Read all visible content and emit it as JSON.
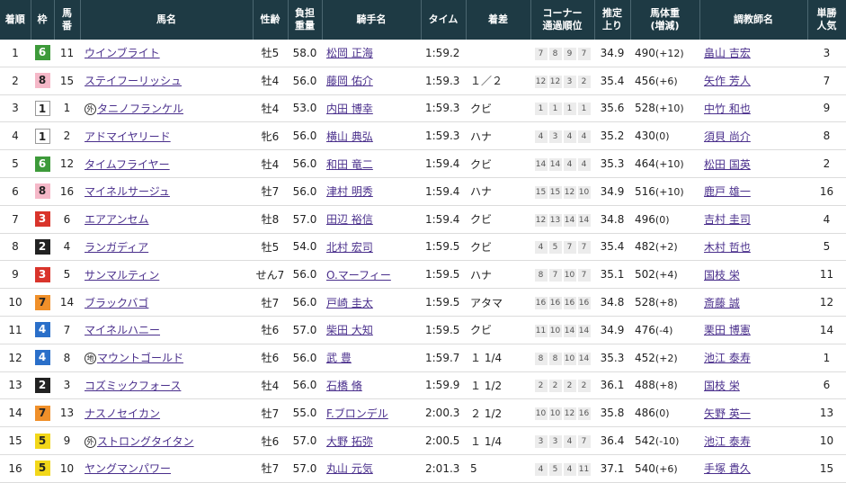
{
  "headers": {
    "rank": "着順",
    "waku": "枠",
    "uma": "馬番",
    "horse": "馬名",
    "sexage": "性齢",
    "weight": "負担重量",
    "jockey": "騎手名",
    "time": "タイム",
    "margin": "着差",
    "corner": "コーナー通過順位",
    "last": "推定上り",
    "bodyweight": "馬体重(増減)",
    "trainer": "調教師名",
    "odds": "単勝人気"
  },
  "mark_labels": {
    "gai": "外",
    "chi": "地"
  },
  "colors": {
    "header_bg": "#1e3a44",
    "link": "#4a2f8c"
  },
  "rows": [
    {
      "rank": "1",
      "waku": "6",
      "uma": "11",
      "mark": "",
      "horse": "ウインブライト",
      "sexage": "牡5",
      "weight": "58.0",
      "jockey": "松岡 正海",
      "time": "1:59.2",
      "margin": "",
      "corner": [
        "7",
        "8",
        "9",
        "7"
      ],
      "last": "34.9",
      "bodyweight": "490",
      "diff": "(+12)",
      "trainer": "畠山 吉宏",
      "odds": "3"
    },
    {
      "rank": "2",
      "waku": "8",
      "uma": "15",
      "mark": "",
      "horse": "ステイフーリッシュ",
      "sexage": "牡4",
      "weight": "56.0",
      "jockey": "藤岡 佑介",
      "time": "1:59.3",
      "margin": "１／２",
      "corner": [
        "12",
        "12",
        "3",
        "2"
      ],
      "last": "35.4",
      "bodyweight": "456",
      "diff": "(+6)",
      "trainer": "矢作 芳人",
      "odds": "7"
    },
    {
      "rank": "3",
      "waku": "1",
      "uma": "1",
      "mark": "外",
      "horse": "タニノフランケル",
      "sexage": "牡4",
      "weight": "53.0",
      "jockey": "内田 博幸",
      "time": "1:59.3",
      "margin": "クビ",
      "corner": [
        "1",
        "1",
        "1",
        "1"
      ],
      "last": "35.6",
      "bodyweight": "528",
      "diff": "(+10)",
      "trainer": "中竹 和也",
      "odds": "9"
    },
    {
      "rank": "4",
      "waku": "1",
      "uma": "2",
      "mark": "",
      "horse": "アドマイヤリード",
      "sexage": "牝6",
      "weight": "56.0",
      "jockey": "横山 典弘",
      "time": "1:59.3",
      "margin": "ハナ",
      "corner": [
        "4",
        "3",
        "4",
        "4"
      ],
      "last": "35.2",
      "bodyweight": "430",
      "diff": "(0)",
      "trainer": "須貝 尚介",
      "odds": "8"
    },
    {
      "rank": "5",
      "waku": "6",
      "uma": "12",
      "mark": "",
      "horse": "タイムフライヤー",
      "sexage": "牡4",
      "weight": "56.0",
      "jockey": "和田 竜二",
      "time": "1:59.4",
      "margin": "クビ",
      "corner": [
        "14",
        "14",
        "4",
        "4"
      ],
      "last": "35.3",
      "bodyweight": "464",
      "diff": "(+10)",
      "trainer": "松田 国英",
      "odds": "2"
    },
    {
      "rank": "6",
      "waku": "8",
      "uma": "16",
      "mark": "",
      "horse": "マイネルサージュ",
      "sexage": "牡7",
      "weight": "56.0",
      "jockey": "津村 明秀",
      "time": "1:59.4",
      "margin": "ハナ",
      "corner": [
        "15",
        "15",
        "12",
        "10"
      ],
      "last": "34.9",
      "bodyweight": "516",
      "diff": "(+10)",
      "trainer": "鹿戸 雄一",
      "odds": "16"
    },
    {
      "rank": "7",
      "waku": "3",
      "uma": "6",
      "mark": "",
      "horse": "エアアンセム",
      "sexage": "牡8",
      "weight": "57.0",
      "jockey": "田辺 裕信",
      "time": "1:59.4",
      "margin": "クビ",
      "corner": [
        "12",
        "13",
        "14",
        "14"
      ],
      "last": "34.8",
      "bodyweight": "496",
      "diff": "(0)",
      "trainer": "吉村 圭司",
      "odds": "4"
    },
    {
      "rank": "8",
      "waku": "2",
      "uma": "4",
      "mark": "",
      "horse": "ランガディア",
      "sexage": "牡5",
      "weight": "54.0",
      "jockey": "北村 宏司",
      "time": "1:59.5",
      "margin": "クビ",
      "corner": [
        "4",
        "5",
        "7",
        "7"
      ],
      "last": "35.4",
      "bodyweight": "482",
      "diff": "(+2)",
      "trainer": "木村 哲也",
      "odds": "5"
    },
    {
      "rank": "9",
      "waku": "3",
      "uma": "5",
      "mark": "",
      "horse": "サンマルティン",
      "sexage": "せん7",
      "weight": "56.0",
      "jockey": "O.マーフィー",
      "time": "1:59.5",
      "margin": "ハナ",
      "corner": [
        "8",
        "7",
        "10",
        "7"
      ],
      "last": "35.1",
      "bodyweight": "502",
      "diff": "(+4)",
      "trainer": "国枝 栄",
      "odds": "11"
    },
    {
      "rank": "10",
      "waku": "7",
      "uma": "14",
      "mark": "",
      "horse": "ブラックバゴ",
      "sexage": "牡7",
      "weight": "56.0",
      "jockey": "戸崎 圭太",
      "time": "1:59.5",
      "margin": "アタマ",
      "corner": [
        "16",
        "16",
        "16",
        "16"
      ],
      "last": "34.8",
      "bodyweight": "528",
      "diff": "(+8)",
      "trainer": "斎藤 誠",
      "odds": "12"
    },
    {
      "rank": "11",
      "waku": "4",
      "uma": "7",
      "mark": "",
      "horse": "マイネルハニー",
      "sexage": "牡6",
      "weight": "57.0",
      "jockey": "柴田 大知",
      "time": "1:59.5",
      "margin": "クビ",
      "corner": [
        "11",
        "10",
        "14",
        "14"
      ],
      "last": "34.9",
      "bodyweight": "476",
      "diff": "(-4)",
      "trainer": "栗田 博憲",
      "odds": "14"
    },
    {
      "rank": "12",
      "waku": "4",
      "uma": "8",
      "mark": "地",
      "horse": "マウントゴールド",
      "sexage": "牡6",
      "weight": "56.0",
      "jockey": "武 豊",
      "time": "1:59.7",
      "margin": "１ 1/4",
      "corner": [
        "8",
        "8",
        "10",
        "14"
      ],
      "last": "35.3",
      "bodyweight": "452",
      "diff": "(+2)",
      "trainer": "池江 泰寿",
      "odds": "1"
    },
    {
      "rank": "13",
      "waku": "2",
      "uma": "3",
      "mark": "",
      "horse": "コズミックフォース",
      "sexage": "牡4",
      "weight": "56.0",
      "jockey": "石橋 脩",
      "time": "1:59.9",
      "margin": "１ 1/2",
      "corner": [
        "2",
        "2",
        "2",
        "2"
      ],
      "last": "36.1",
      "bodyweight": "488",
      "diff": "(+8)",
      "trainer": "国枝 栄",
      "odds": "6"
    },
    {
      "rank": "14",
      "waku": "7",
      "uma": "13",
      "mark": "",
      "horse": "ナスノセイカン",
      "sexage": "牡7",
      "weight": "55.0",
      "jockey": "F.ブロンデル",
      "time": "2:00.3",
      "margin": "２ 1/2",
      "corner": [
        "10",
        "10",
        "12",
        "16"
      ],
      "last": "35.8",
      "bodyweight": "486",
      "diff": "(0)",
      "trainer": "矢野 英一",
      "odds": "13"
    },
    {
      "rank": "15",
      "waku": "5",
      "uma": "9",
      "mark": "外",
      "horse": "ストロングタイタン",
      "sexage": "牡6",
      "weight": "57.0",
      "jockey": "大野 拓弥",
      "time": "2:00.5",
      "margin": "１ 1/4",
      "corner": [
        "3",
        "3",
        "4",
        "7"
      ],
      "last": "36.4",
      "bodyweight": "542",
      "diff": "(-10)",
      "trainer": "池江 泰寿",
      "odds": "10"
    },
    {
      "rank": "16",
      "waku": "5",
      "uma": "10",
      "mark": "",
      "horse": "ヤングマンパワー",
      "sexage": "牡7",
      "weight": "57.0",
      "jockey": "丸山 元気",
      "time": "2:01.3",
      "margin": "5",
      "corner": [
        "4",
        "5",
        "4",
        "11"
      ],
      "last": "37.1",
      "bodyweight": "540",
      "diff": "(+6)",
      "trainer": "手塚 貴久",
      "odds": "15"
    }
  ]
}
